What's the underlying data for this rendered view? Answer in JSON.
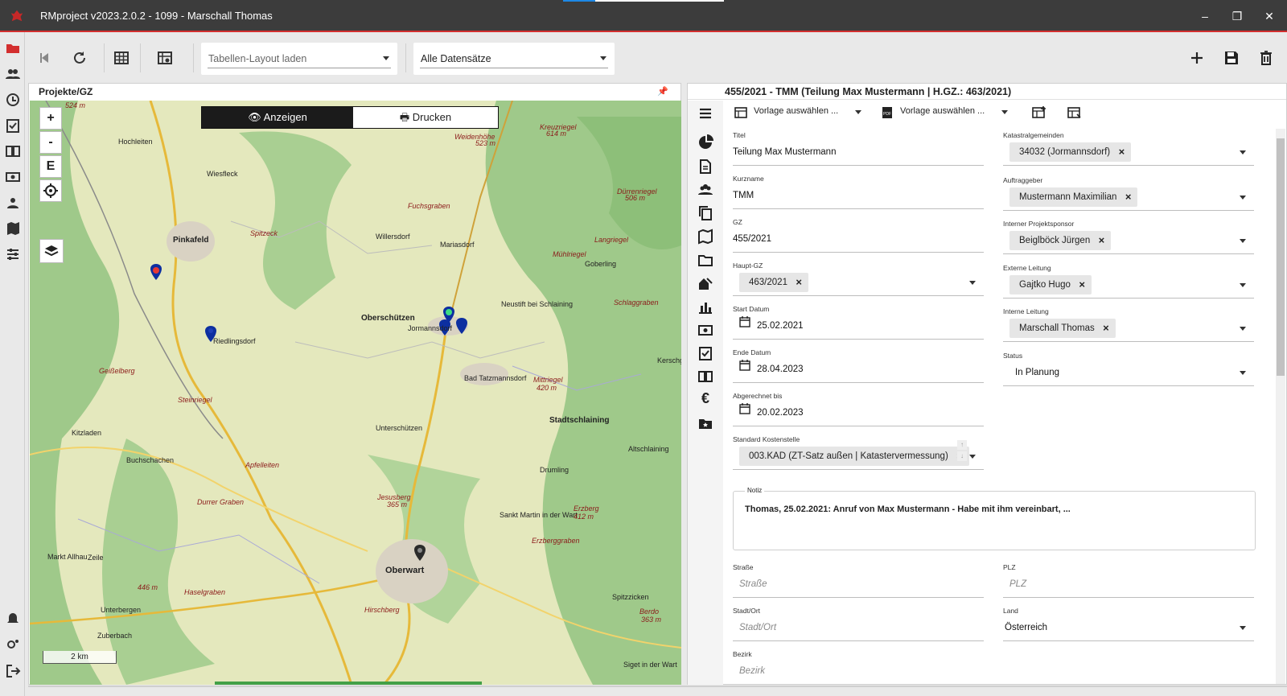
{
  "app": {
    "title": "RMproject v2023.2.0.2 - 1099 - Marschall Thomas",
    "accent": "#d32f2f"
  },
  "toolbar": {
    "layout_dropdown": "Tabellen-Layout laden",
    "records_dropdown": "Alle Datensätze"
  },
  "left_panel": {
    "header": "Projekte/GZ",
    "map": {
      "zoom_in": "+",
      "zoom_out": "-",
      "extent": "E",
      "show_label": "Anzeigen",
      "print_label": "Drucken",
      "scale": "2 km",
      "places": [
        "Hochleiten",
        "Pinkafeld",
        "Spitzeck",
        "Oberschützen",
        "Jormannsdorf",
        "Riedlingsdorf",
        "Bad Tatzmannsdorf",
        "Stadtschlaining",
        "Unterschützen",
        "Oberwart",
        "Buchschachen",
        "Geißelberg",
        "Steinriegel",
        "Apfelleiten",
        "Durrer Graben",
        "Haselgraben",
        "Jesusberg",
        "Hirschberg",
        "Zeile",
        "Markt Allhau",
        "Unterbergen",
        "Zuberbach",
        "Fuchsgraben",
        "Mariasdorf",
        "Willersdorf",
        "Neustift bei Schlaining",
        "Goberling",
        "Drumling",
        "Erzberg",
        "Schlaggraben",
        "Langriegel",
        "Mühlriegel",
        "Mittriegel",
        "Kreuzriegel",
        "Dürrenriegel",
        "Weidenhöhe",
        "Kitzladen",
        "Siget in der Wart",
        "Sankt Martin in der Wart",
        "Erzberggraben",
        "Spitzzicken",
        "Berdo",
        "Altschlaining",
        "Kerschg",
        "Wiesfleck"
      ],
      "hills": [
        "524 m",
        "523 m",
        "614 m",
        "506 m",
        "420 m",
        "412 m",
        "365 m",
        "446 m",
        "363 m"
      ]
    }
  },
  "right_panel": {
    "header": "455/2021 - TMM (Teilung Max Mustermann | H.GZ.: 463/2021)",
    "tool_vorlage1": "Vorlage auswählen ...",
    "tool_vorlage2": "Vorlage auswählen ...",
    "fields": {
      "titel": {
        "label": "Titel",
        "value": "Teilung Max Mustermann"
      },
      "kurzname": {
        "label": "Kurzname",
        "value": "TMM"
      },
      "gz": {
        "label": "GZ",
        "value": "455/2021"
      },
      "haupt_gz": {
        "label": "Haupt-GZ",
        "value": "463/2021"
      },
      "start": {
        "label": "Start Datum",
        "value": "25.02.2021"
      },
      "ende": {
        "label": "Ende Datum",
        "value": "28.04.2023"
      },
      "abgerechnet": {
        "label": "Abgerechnet bis",
        "value": "20.02.2023"
      },
      "kostenstelle": {
        "label": "Standard Kostenstelle",
        "value": "003.KAD (ZT-Satz außen | Katastervermessung)"
      },
      "katastral": {
        "label": "Katastralgemeinden",
        "value": "34032 (Jormannsdorf)"
      },
      "auftraggeber": {
        "label": "Auftraggeber",
        "value": "Mustermann Maximilian"
      },
      "sponsor": {
        "label": "Interner Projektsponsor",
        "value": "Beiglböck Jürgen"
      },
      "externe": {
        "label": "Externe Leitung",
        "value": "Gajtko Hugo"
      },
      "interne": {
        "label": "Interne Leitung",
        "value": "Marschall Thomas"
      },
      "status": {
        "label": "Status",
        "value": "In Planung"
      },
      "notiz": {
        "label": "Notiz",
        "value": "Thomas, 25.02.2021: Anruf von Max Mustermann - Habe mit ihm vereinbart, ..."
      },
      "strasse": {
        "label": "Straße",
        "placeholder": "Straße"
      },
      "plz": {
        "label": "PLZ",
        "placeholder": "PLZ"
      },
      "stadt": {
        "label": "Stadt/Ort",
        "placeholder": "Stadt/Ort"
      },
      "land": {
        "label": "Land",
        "value": "Österreich"
      },
      "bezirk": {
        "label": "Bezirk",
        "placeholder": "Bezirk"
      }
    }
  }
}
